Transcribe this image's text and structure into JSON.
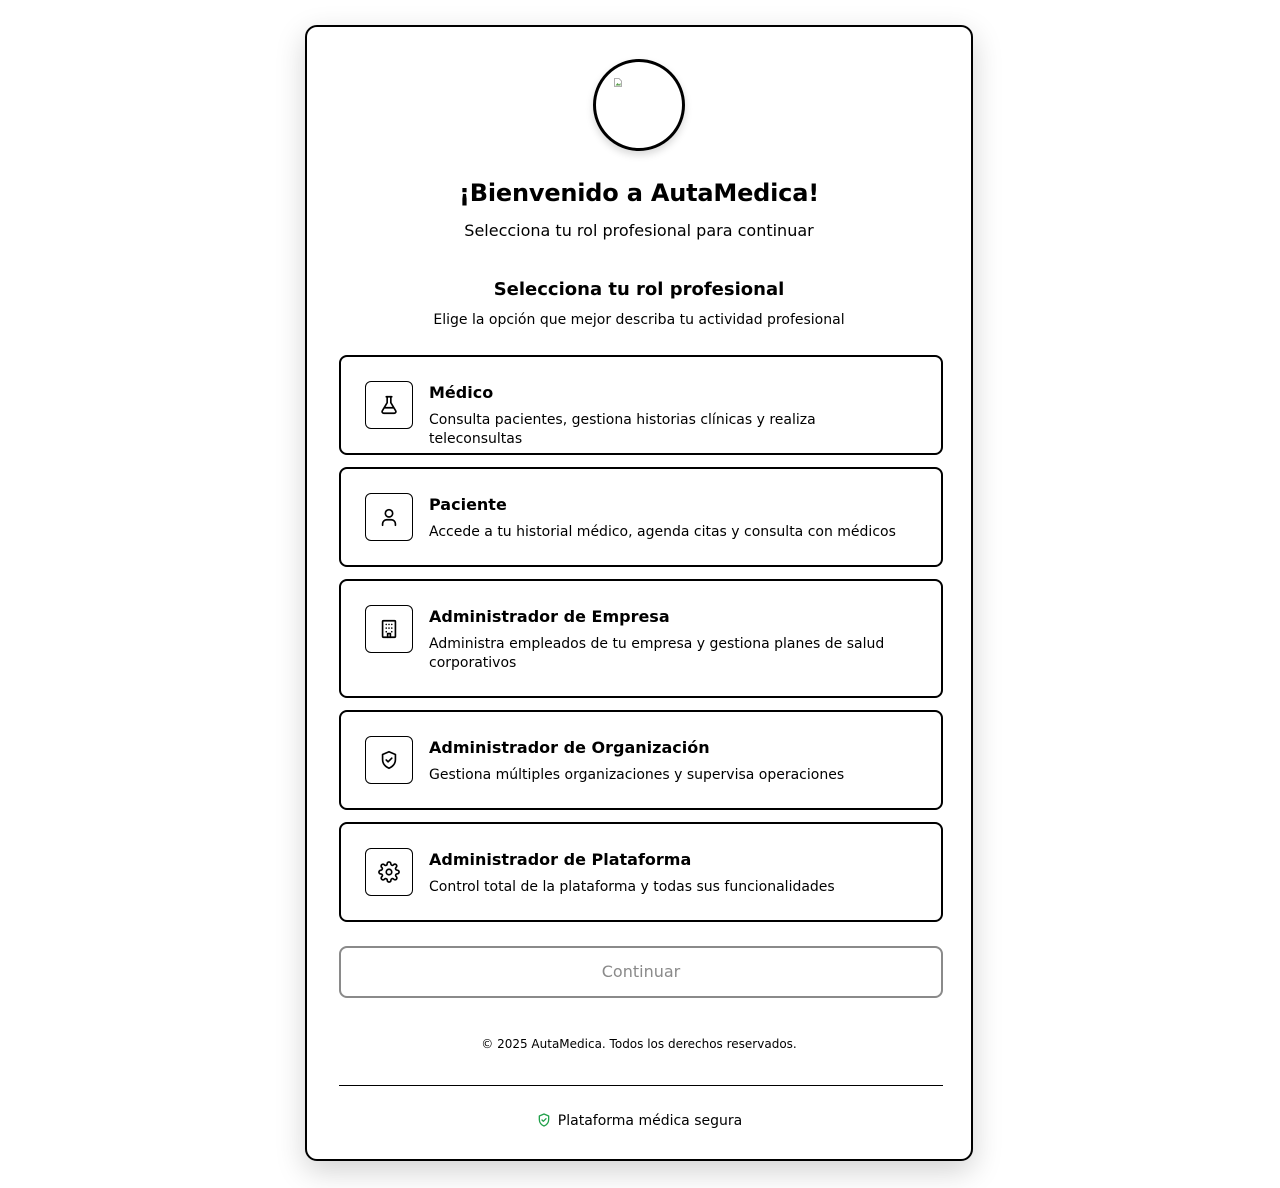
{
  "header": {
    "title": "¡Bienvenido a AutaMedica!",
    "subtitle": "Selecciona tu rol profesional para continuar"
  },
  "roles_section": {
    "title": "Selecciona tu rol profesional",
    "subtitle": "Elige la opción que mejor describa tu actividad profesional"
  },
  "roles": [
    {
      "icon": "flask-icon",
      "title": "Médico",
      "description": "Consulta pacientes, gestiona historias clínicas y realiza teleconsultas"
    },
    {
      "icon": "user-icon",
      "title": "Paciente",
      "description": "Accede a tu historial médico, agenda citas y consulta con médicos"
    },
    {
      "icon": "building-icon",
      "title": "Administrador de Empresa",
      "description": "Administra empleados de tu empresa y gestiona planes de salud corporativos"
    },
    {
      "icon": "shield-check-icon",
      "title": "Administrador de Organización",
      "description": "Gestiona múltiples organizaciones y supervisa operaciones"
    },
    {
      "icon": "gear-icon",
      "title": "Administrador de Plataforma",
      "description": "Control total de la plataforma y todas sus funcionalidades"
    }
  ],
  "actions": {
    "continue_label": "Continuar"
  },
  "footer": {
    "copyright": "© 2025 AutaMedica. Todos los derechos reservados.",
    "secure_label": "Plataforma médica segura",
    "secure_icon_color": "#22a04b"
  }
}
